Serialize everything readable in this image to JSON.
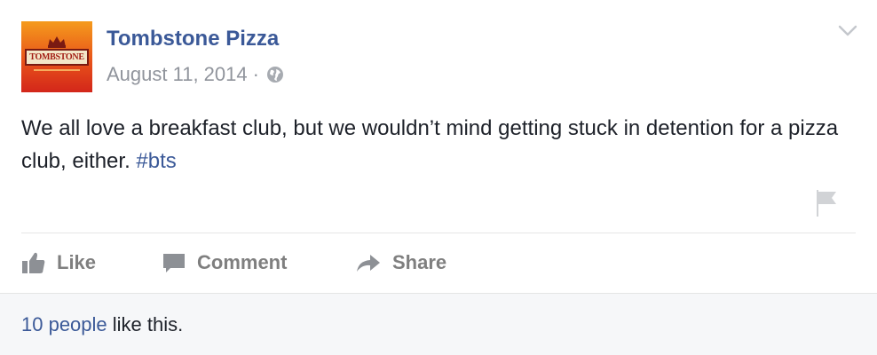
{
  "page": {
    "name": "Tombstone Pizza",
    "avatar_text": "TOMBSTONE",
    "avatar_colors": [
      "#f59b1c",
      "#e8531a",
      "#d3261a"
    ]
  },
  "post": {
    "date": "August 11, 2014",
    "separator": "·",
    "privacy_icon": "globe-icon",
    "text_before_hashtag": "We all love a breakfast club, but we wouldn’t mind getting stuck in detention for a pizza club, either. ",
    "hashtag": "#bts"
  },
  "actions": {
    "like_label": "Like",
    "comment_label": "Comment",
    "share_label": "Share"
  },
  "likes_summary": {
    "count_link": "10 people",
    "suffix": " like this."
  },
  "colors": {
    "link": "#3b5998",
    "meta": "#90949c",
    "text": "#1d2129",
    "action": "#7f7f7f",
    "footer_bg": "#f6f7f9"
  }
}
